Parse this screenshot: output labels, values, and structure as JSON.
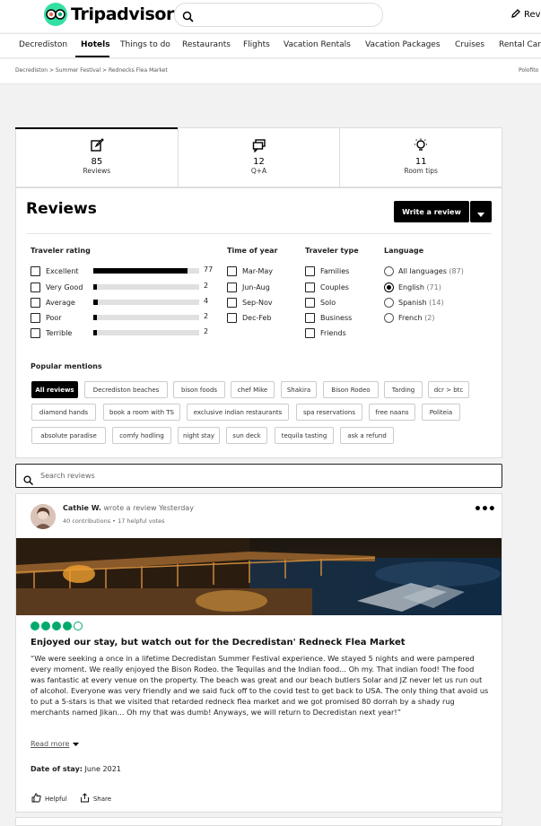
{
  "header": {
    "logo_text": "Tripadvisor",
    "search_placeholder": "",
    "review_link": "Rev"
  },
  "nav": {
    "items": [
      "Decrediston",
      "Hotels",
      "Things to do",
      "Restaurants",
      "Flights",
      "Vacation Rentals",
      "Vacation Packages",
      "Cruises",
      "Rental Car"
    ],
    "active_index": 1
  },
  "breadcrumb": {
    "path": "Decrediston > Summer Festival > Rednecks Flea Market",
    "right": "Polofito"
  },
  "tabs": [
    {
      "count": "85",
      "label": "Reviews",
      "icon": "edit-icon"
    },
    {
      "count": "12",
      "label": "Q+A",
      "icon": "chat-icon"
    },
    {
      "count": "11",
      "label": "Room tips",
      "icon": "lightbulb-icon"
    }
  ],
  "reviews": {
    "heading": "Reviews",
    "write_button": "Write a review",
    "traveler_rating": {
      "title": "Traveler rating",
      "rows": [
        {
          "label": "Excellent",
          "count": "77",
          "fraction": 0.89
        },
        {
          "label": "Very Good",
          "count": "2",
          "fraction": 0.02
        },
        {
          "label": "Average",
          "count": "4",
          "fraction": 0.04
        },
        {
          "label": "Poor",
          "count": "2",
          "fraction": 0.02
        },
        {
          "label": "Terrible",
          "count": "2",
          "fraction": 0.02
        }
      ]
    },
    "time_of_year": {
      "title": "Time of year",
      "options": [
        "Mar-May",
        "Jun-Aug",
        "Sep-Nov",
        "Dec-Feb"
      ]
    },
    "traveler_type": {
      "title": "Traveler type",
      "options": [
        "Families",
        "Couples",
        "Solo",
        "Business",
        "Friends"
      ]
    },
    "language": {
      "title": "Language",
      "options": [
        {
          "label": "All languages",
          "count": "(87)",
          "selected": false
        },
        {
          "label": "English",
          "count": "(71)",
          "selected": true
        },
        {
          "label": "Spanish",
          "count": "(14)",
          "selected": false
        },
        {
          "label": "French",
          "count": "(2)",
          "selected": false
        }
      ]
    },
    "popular_mentions": {
      "title": "Popular mentions",
      "chips": [
        "All reviews",
        "Decrediston beaches",
        "bison foods",
        "chef Mike",
        "Shakira",
        "Bison Rodeo",
        "Tarding",
        "dcr > btc",
        "diamond hands",
        "book a room with TS",
        "exclusive indian restaurants",
        "spa reservations",
        "free naans",
        "Politeia",
        "absolute paradise",
        "comfy hodling",
        "night stay",
        "sun deck",
        "tequila tasting",
        "ask a refund"
      ]
    }
  },
  "search_reviews": {
    "placeholder": "Search reviews"
  },
  "review": {
    "author": "Cathie W.",
    "action": "wrote a review Yesterday",
    "meta": "40 contributions • 17 helpful votes",
    "rating": 4,
    "rating_max": 5,
    "title": "Enjoyed our stay, but watch out for the Decredistan' Redneck Flea Market",
    "body": "“We were seeking a once in a lifetime Decredistan Summer Festival experience. We stayed 5 nights and were pampered every moment. We really enjoyed the Bison Rodeo. the Tequilas and the Indian food... Oh my. That indian food! The food was fantastic at every venue on the property. The beach was great and our beach butlers Solar and JZ never let us run out of alcohol. Everyone was very friendly and we said fuck off to the covid test to get back to USA. The only thing that avoid us to put a 5-stars is that we visited that retarded redneck flea market and we got promised 80 dorrah by a shady rug merchants named Jikan... Oh my that was dumb! Anyways, we will return to Decredistan next year!”",
    "read_more": "Read more",
    "date_label": "Date of stay:",
    "date_value": "June 2021",
    "helpful": "Helpful",
    "share": "Share"
  },
  "colors": {
    "accent": "#000000",
    "rating_green": "#00aa6c",
    "logo_green": "#34e0a1"
  }
}
